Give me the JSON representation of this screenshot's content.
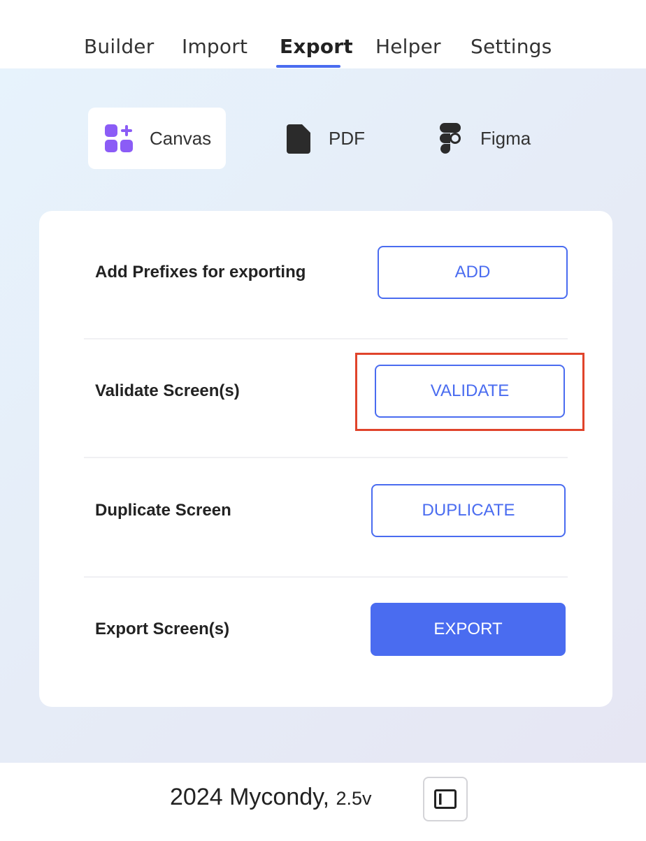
{
  "tabs": [
    {
      "label": "Builder"
    },
    {
      "label": "Import"
    },
    {
      "label": "Export"
    },
    {
      "label": "Helper"
    },
    {
      "label": "Settings"
    }
  ],
  "active_tab": "Export",
  "export_types": [
    {
      "label": "Canvas",
      "icon": "canvas-grid-icon",
      "selected": true
    },
    {
      "label": "PDF",
      "icon": "document-icon",
      "selected": false
    },
    {
      "label": "Figma",
      "icon": "figma-icon",
      "selected": false
    }
  ],
  "rows": [
    {
      "label": "Add Prefixes for exporting",
      "button": "ADD"
    },
    {
      "label": "Validate Screen(s)",
      "button": "VALIDATE"
    },
    {
      "label": "Duplicate Screen",
      "button": "DUPLICATE"
    },
    {
      "label": "Export Screen(s)",
      "button": "EXPORT"
    }
  ],
  "footer": {
    "text": "2024 Mycondy,",
    "version": "2.5v",
    "toggle_icon": "sidebar-toggle-icon"
  },
  "colors": {
    "accent": "#4a6cf0",
    "highlight": "#e0442b",
    "canvas_icon": "#8b5cf6"
  }
}
